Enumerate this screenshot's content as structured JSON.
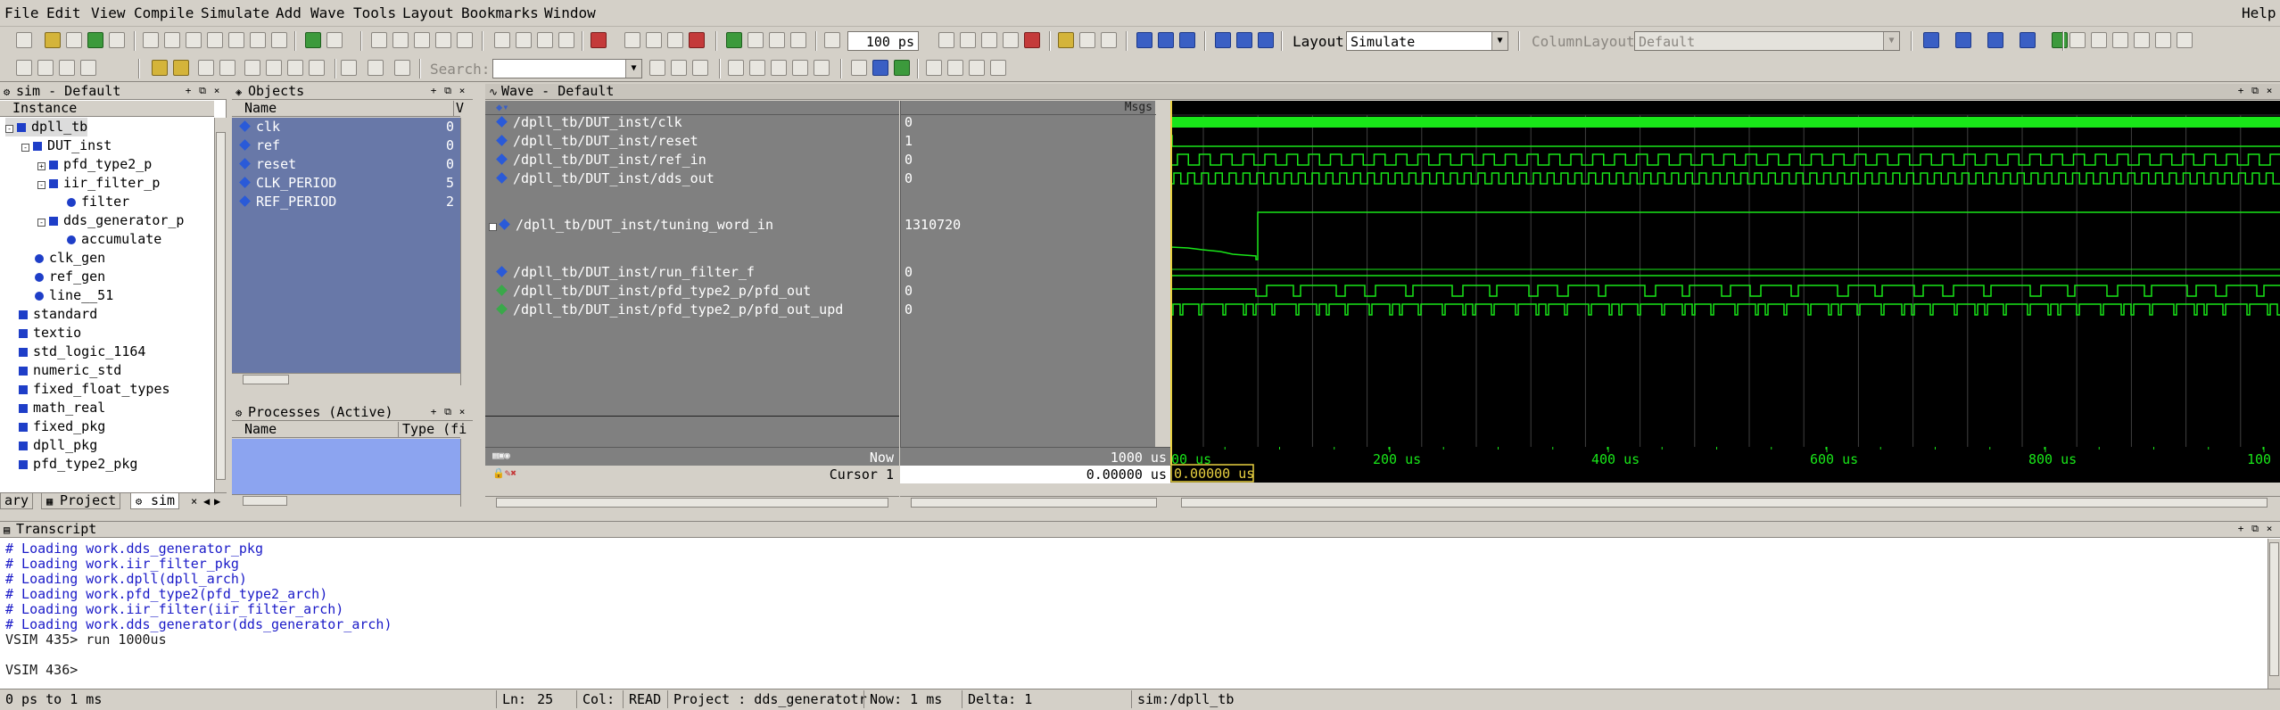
{
  "menubar": {
    "items": [
      "File",
      "Edit",
      "View",
      "Compile",
      "Simulate",
      "Add",
      "Wave",
      "Tools",
      "Layout",
      "Bookmarks",
      "Window"
    ],
    "help": "Help"
  },
  "toolbar": {
    "time_step": "100 ps",
    "layout_label": "Layout",
    "layout_value": "Simulate",
    "column_layout_label": "ColumnLayout",
    "column_layout_value": "Default",
    "search_label": "Search:",
    "search_value": ""
  },
  "sim_panel": {
    "title": "sim - Default",
    "column_header": "Instance",
    "tree": [
      {
        "label": "dpll_tb",
        "icon": "square",
        "expander": "-",
        "indent": 0
      },
      {
        "label": "DUT_inst",
        "icon": "square",
        "expander": "-",
        "indent": 1
      },
      {
        "label": "pfd_type2_p",
        "icon": "square",
        "expander": "+",
        "indent": 2
      },
      {
        "label": "iir_filter_p",
        "icon": "square",
        "expander": "-",
        "indent": 2
      },
      {
        "label": "filter",
        "icon": "ball",
        "expander": "",
        "indent": 3
      },
      {
        "label": "dds_generator_p",
        "icon": "square",
        "expander": "-",
        "indent": 2
      },
      {
        "label": "accumulate",
        "icon": "ball",
        "expander": "",
        "indent": 3
      },
      {
        "label": "clk_gen",
        "icon": "ball",
        "expander": "",
        "indent": 1
      },
      {
        "label": "ref_gen",
        "icon": "ball",
        "expander": "",
        "indent": 1
      },
      {
        "label": "line__51",
        "icon": "ball",
        "expander": "",
        "indent": 1
      },
      {
        "label": "standard",
        "icon": "square",
        "expander": "",
        "indent": 0
      },
      {
        "label": "textio",
        "icon": "square",
        "expander": "",
        "indent": 0
      },
      {
        "label": "std_logic_1164",
        "icon": "square",
        "expander": "",
        "indent": 0
      },
      {
        "label": "numeric_std",
        "icon": "square",
        "expander": "",
        "indent": 0
      },
      {
        "label": "fixed_float_types",
        "icon": "square",
        "expander": "",
        "indent": 0
      },
      {
        "label": "math_real",
        "icon": "square",
        "expander": "",
        "indent": 0
      },
      {
        "label": "fixed_pkg",
        "icon": "square",
        "expander": "",
        "indent": 0
      },
      {
        "label": "dpll_pkg",
        "icon": "square",
        "expander": "",
        "indent": 0
      },
      {
        "label": "pfd_type2_pkg",
        "icon": "square",
        "expander": "",
        "indent": 0
      }
    ],
    "tabs": [
      "ary",
      "Project",
      "sim"
    ]
  },
  "objects_panel": {
    "title": "Objects",
    "column_header": "Name",
    "column_header2": "V",
    "items": [
      {
        "name": "clk",
        "value": "0"
      },
      {
        "name": "ref",
        "value": "0"
      },
      {
        "name": "reset",
        "value": "0"
      },
      {
        "name": "CLK_PERIOD",
        "value": "5"
      },
      {
        "name": "REF_PERIOD",
        "value": "2"
      }
    ]
  },
  "processes_panel": {
    "title": "Processes (Active)",
    "col_name": "Name",
    "col_type": "Type (fi"
  },
  "wave_panel": {
    "title": "Wave - Default",
    "msgs_header": "Msgs",
    "signals": [
      {
        "name": "/dpll_tb/DUT_inst/clk",
        "value": "0",
        "expandable": false
      },
      {
        "name": "/dpll_tb/DUT_inst/reset",
        "value": "1",
        "expandable": false
      },
      {
        "name": "/dpll_tb/DUT_inst/ref_in",
        "value": "0",
        "expandable": false
      },
      {
        "name": "/dpll_tb/DUT_inst/dds_out",
        "value": "0",
        "expandable": false
      },
      {
        "name": "/dpll_tb/DUT_inst/tuning_word_in",
        "value": "1310720",
        "expandable": true
      },
      {
        "name": "/dpll_tb/DUT_inst/run_filter_f",
        "value": "0",
        "expandable": false
      },
      {
        "name": "/dpll_tb/DUT_inst/pfd_type2_p/pfd_out",
        "value": "0",
        "expandable": false
      },
      {
        "name": "/dpll_tb/DUT_inst/pfd_type2_p/pfd_out_upd",
        "value": "0",
        "expandable": false
      }
    ],
    "now_label": "Now",
    "now_value": "1000 us",
    "cursor_label": "Cursor 1",
    "cursor_value": "0.00000 us",
    "cursor_marker": "0.00000 us",
    "time_ticks": [
      "00 us",
      "200 us",
      "400 us",
      "600 us",
      "800 us",
      "100"
    ],
    "colors": {
      "wave": "#19e619",
      "bg": "#000000",
      "grid": "#404040",
      "cursor": "#e8d040"
    }
  },
  "transcript": {
    "title": "Transcript",
    "lines": [
      {
        "text": "# Loading work.dds_generator_pkg",
        "kind": "info"
      },
      {
        "text": "# Loading work.iir_filter_pkg",
        "kind": "info"
      },
      {
        "text": "# Loading work.dpll(dpll_arch)",
        "kind": "info"
      },
      {
        "text": "# Loading work.pfd_type2(pfd_type2_arch)",
        "kind": "info"
      },
      {
        "text": "# Loading work.iir_filter(iir_filter_arch)",
        "kind": "info"
      },
      {
        "text": "# Loading work.dds_generator(dds_generator_arch)",
        "kind": "info"
      },
      {
        "text": "VSIM 435> run 1000us",
        "kind": "cmd"
      },
      {
        "text": "",
        "kind": "cmd"
      },
      {
        "text": "VSIM 436>",
        "kind": "cmd"
      }
    ]
  },
  "statusbar": {
    "range": "0 ps to 1 ms",
    "ln_label": "Ln:",
    "ln_value": "25",
    "col_label": "Col:",
    "mode": "READ",
    "project": "Project : dds_generatotr",
    "now": "Now: 1 ms",
    "delta": "Delta: 1",
    "context": "sim:/dpll_tb"
  }
}
